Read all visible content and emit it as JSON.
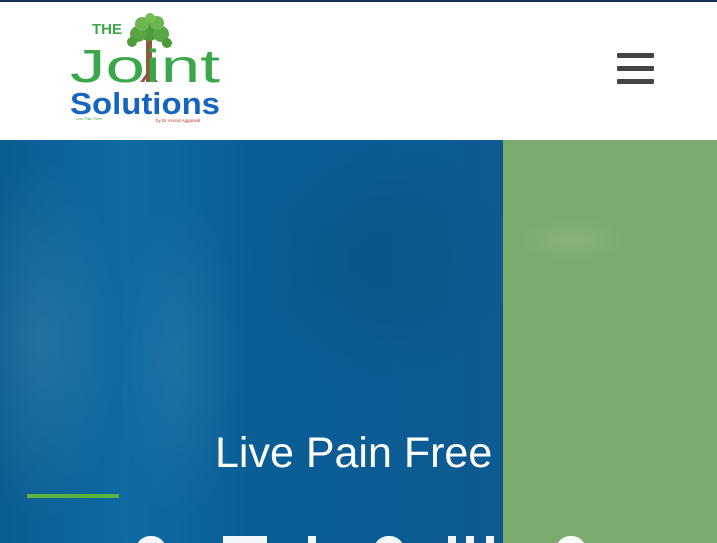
{
  "header": {
    "logo": {
      "line1_prefix": "THE",
      "line1": "Joint",
      "line2": "Solutions",
      "tagline_small": "Live Pain Free",
      "byline": "by Dr Arvind Aggarwal"
    },
    "menu_icon": "hamburger-menu-icon"
  },
  "hero": {
    "tagline": "Live Pain Free"
  },
  "colors": {
    "brand_blue": "#0b5e96",
    "brand_green": "#7aab6d",
    "accent_green": "#5cb33e",
    "logo_blue": "#1565c0",
    "logo_green": "#3aa84a",
    "logo_red": "#c0392b"
  }
}
